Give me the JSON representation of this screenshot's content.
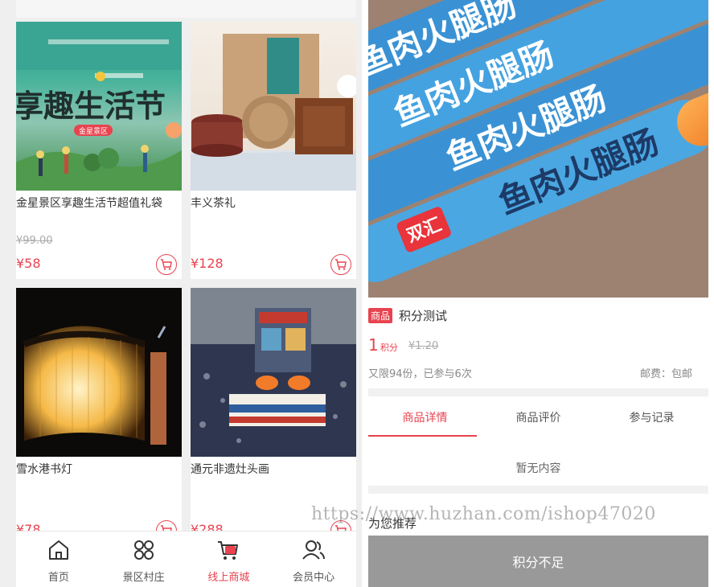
{
  "left": {
    "products": [
      {
        "title": "金星景区享趣生活节超值礼袋",
        "old_price": "¥99.00",
        "price": "¥58",
        "image_text_main": "享趣生活节",
        "image_text_tag": "金星景区"
      },
      {
        "title": "丰义茶礼",
        "old_price": "",
        "price": "¥128"
      },
      {
        "title": "雪水港书灯",
        "old_price": "",
        "price": "¥78"
      },
      {
        "title": "通元非遗灶头画",
        "old_price": "",
        "price": "¥288"
      }
    ],
    "tabbar": [
      {
        "label": "首页",
        "icon": "home-icon"
      },
      {
        "label": "景区村庄",
        "icon": "grid-icon"
      },
      {
        "label": "线上商城",
        "icon": "cart-icon"
      },
      {
        "label": "会员中心",
        "icon": "users-icon"
      }
    ],
    "active_tab_color": "#e8434f"
  },
  "right": {
    "hero_text": "鱼肉火腿肠",
    "hero_brand": "双汇",
    "badge": "商品",
    "product_name": "积分测试",
    "points": "1",
    "points_unit": "积分",
    "orig_price": "¥1.20",
    "limit_text": "又限94份，已参与6次",
    "shipping": "邮费：包邮",
    "tabs": [
      "商品详情",
      "商品评价",
      "参与记录"
    ],
    "empty_text": "暂无内容",
    "recommend_title": "为您推荐",
    "insufficient_button": "积分不足"
  },
  "watermark": "https://www.huzhan.com/ishop47020",
  "colors": {
    "accent": "#e8434f",
    "button_gray": "#999999",
    "page_bg": "#efefef"
  }
}
